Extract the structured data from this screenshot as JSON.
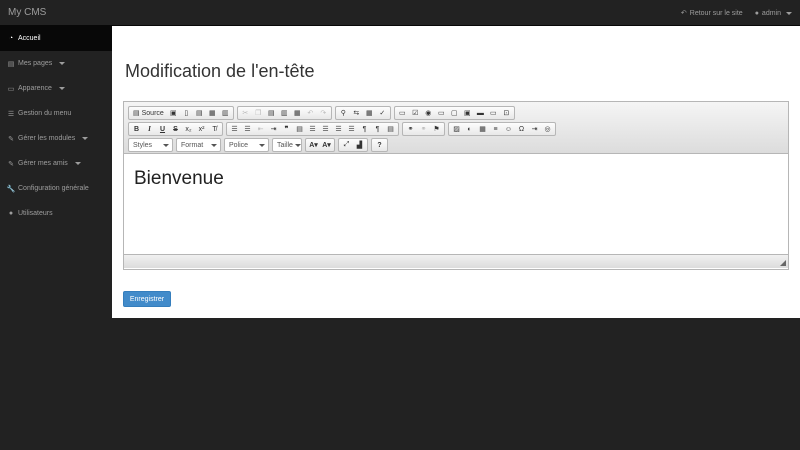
{
  "app": {
    "brand": "My CMS"
  },
  "topbar": {
    "back_link": "Retour sur le site",
    "user": "admin"
  },
  "sidebar": {
    "items": [
      {
        "label": "Accueil",
        "icon": "dashboard-icon",
        "dropdown": false,
        "active": true
      },
      {
        "label": "Mes pages",
        "icon": "file-icon",
        "dropdown": true,
        "active": false
      },
      {
        "label": "Apparence",
        "icon": "monitor-icon",
        "dropdown": true,
        "active": false
      },
      {
        "label": "Gestion du menu",
        "icon": "list-icon",
        "dropdown": false,
        "active": false
      },
      {
        "label": "Gérer les modules",
        "icon": "pencil-icon",
        "dropdown": true,
        "active": false
      },
      {
        "label": "Gérer mes amis",
        "icon": "pencil-icon",
        "dropdown": true,
        "active": false
      },
      {
        "label": "Configuration générale",
        "icon": "wrench-icon",
        "dropdown": false,
        "active": false
      },
      {
        "label": "Utilisateurs",
        "icon": "user-icon",
        "dropdown": false,
        "active": false
      }
    ]
  },
  "main": {
    "title": "Modification de l'en-tête",
    "editor": {
      "source_label": "Source",
      "bold": "B",
      "italic": "I",
      "underline": "U",
      "strike": "S",
      "subscript": "x₂",
      "superscript": "x²",
      "combos": {
        "styles": "Styles",
        "format": "Format",
        "font": "Police",
        "size": "Taille"
      },
      "help": "?",
      "content": "Bienvenue"
    },
    "save_label": "Enregistrer"
  }
}
